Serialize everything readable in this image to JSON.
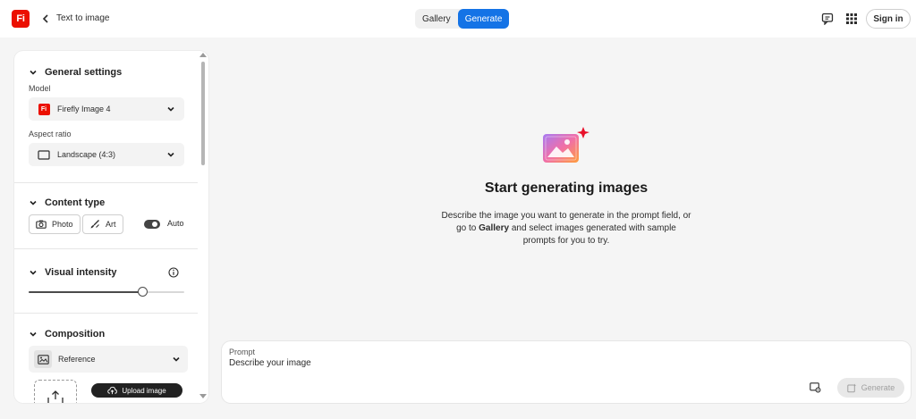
{
  "header": {
    "logo_text": "Fi",
    "title": "Text to image",
    "tabs": [
      {
        "label": "Gallery",
        "active": false
      },
      {
        "label": "Generate",
        "active": true
      }
    ],
    "sign_in_label": "Sign in",
    "accent_color": "#1473e6",
    "brand_color": "#eb1000"
  },
  "sidebar": {
    "general": {
      "heading": "General settings",
      "model_label": "Model",
      "model_value": "Firefly Image 4",
      "model_icon_text": "Fi",
      "aspect_label": "Aspect ratio",
      "aspect_value": "Landscape (4:3)"
    },
    "content_type": {
      "heading": "Content type",
      "photo_label": "Photo",
      "art_label": "Art",
      "auto_label": "Auto",
      "auto_on": true
    },
    "visual_intensity": {
      "heading": "Visual intensity",
      "value_fraction": 0.73
    },
    "composition": {
      "heading": "Composition",
      "reference_label": "Reference",
      "upload_label": "Upload image"
    }
  },
  "main": {
    "title": "Start generating images",
    "desc_part1": "Describe the image you want to generate in the prompt field, or go to ",
    "desc_bold": "Gallery",
    "desc_part2": " and select images generated with sample prompts for you to try."
  },
  "prompt": {
    "label": "Prompt",
    "placeholder": "Describe your image",
    "generate_label": "Generate"
  }
}
